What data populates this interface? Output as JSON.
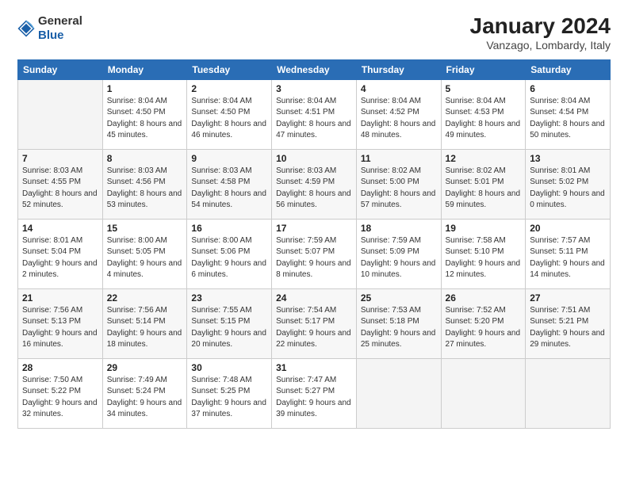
{
  "logo": {
    "general": "General",
    "blue": "Blue"
  },
  "title": "January 2024",
  "subtitle": "Vanzago, Lombardy, Italy",
  "days": [
    "Sunday",
    "Monday",
    "Tuesday",
    "Wednesday",
    "Thursday",
    "Friday",
    "Saturday"
  ],
  "weeks": [
    [
      {
        "date": "",
        "sunrise": "",
        "sunset": "",
        "daylight": ""
      },
      {
        "date": "1",
        "sunrise": "Sunrise: 8:04 AM",
        "sunset": "Sunset: 4:50 PM",
        "daylight": "Daylight: 8 hours and 45 minutes."
      },
      {
        "date": "2",
        "sunrise": "Sunrise: 8:04 AM",
        "sunset": "Sunset: 4:50 PM",
        "daylight": "Daylight: 8 hours and 46 minutes."
      },
      {
        "date": "3",
        "sunrise": "Sunrise: 8:04 AM",
        "sunset": "Sunset: 4:51 PM",
        "daylight": "Daylight: 8 hours and 47 minutes."
      },
      {
        "date": "4",
        "sunrise": "Sunrise: 8:04 AM",
        "sunset": "Sunset: 4:52 PM",
        "daylight": "Daylight: 8 hours and 48 minutes."
      },
      {
        "date": "5",
        "sunrise": "Sunrise: 8:04 AM",
        "sunset": "Sunset: 4:53 PM",
        "daylight": "Daylight: 8 hours and 49 minutes."
      },
      {
        "date": "6",
        "sunrise": "Sunrise: 8:04 AM",
        "sunset": "Sunset: 4:54 PM",
        "daylight": "Daylight: 8 hours and 50 minutes."
      }
    ],
    [
      {
        "date": "7",
        "sunrise": "Sunrise: 8:03 AM",
        "sunset": "Sunset: 4:55 PM",
        "daylight": "Daylight: 8 hours and 52 minutes."
      },
      {
        "date": "8",
        "sunrise": "Sunrise: 8:03 AM",
        "sunset": "Sunset: 4:56 PM",
        "daylight": "Daylight: 8 hours and 53 minutes."
      },
      {
        "date": "9",
        "sunrise": "Sunrise: 8:03 AM",
        "sunset": "Sunset: 4:58 PM",
        "daylight": "Daylight: 8 hours and 54 minutes."
      },
      {
        "date": "10",
        "sunrise": "Sunrise: 8:03 AM",
        "sunset": "Sunset: 4:59 PM",
        "daylight": "Daylight: 8 hours and 56 minutes."
      },
      {
        "date": "11",
        "sunrise": "Sunrise: 8:02 AM",
        "sunset": "Sunset: 5:00 PM",
        "daylight": "Daylight: 8 hours and 57 minutes."
      },
      {
        "date": "12",
        "sunrise": "Sunrise: 8:02 AM",
        "sunset": "Sunset: 5:01 PM",
        "daylight": "Daylight: 8 hours and 59 minutes."
      },
      {
        "date": "13",
        "sunrise": "Sunrise: 8:01 AM",
        "sunset": "Sunset: 5:02 PM",
        "daylight": "Daylight: 9 hours and 0 minutes."
      }
    ],
    [
      {
        "date": "14",
        "sunrise": "Sunrise: 8:01 AM",
        "sunset": "Sunset: 5:04 PM",
        "daylight": "Daylight: 9 hours and 2 minutes."
      },
      {
        "date": "15",
        "sunrise": "Sunrise: 8:00 AM",
        "sunset": "Sunset: 5:05 PM",
        "daylight": "Daylight: 9 hours and 4 minutes."
      },
      {
        "date": "16",
        "sunrise": "Sunrise: 8:00 AM",
        "sunset": "Sunset: 5:06 PM",
        "daylight": "Daylight: 9 hours and 6 minutes."
      },
      {
        "date": "17",
        "sunrise": "Sunrise: 7:59 AM",
        "sunset": "Sunset: 5:07 PM",
        "daylight": "Daylight: 9 hours and 8 minutes."
      },
      {
        "date": "18",
        "sunrise": "Sunrise: 7:59 AM",
        "sunset": "Sunset: 5:09 PM",
        "daylight": "Daylight: 9 hours and 10 minutes."
      },
      {
        "date": "19",
        "sunrise": "Sunrise: 7:58 AM",
        "sunset": "Sunset: 5:10 PM",
        "daylight": "Daylight: 9 hours and 12 minutes."
      },
      {
        "date": "20",
        "sunrise": "Sunrise: 7:57 AM",
        "sunset": "Sunset: 5:11 PM",
        "daylight": "Daylight: 9 hours and 14 minutes."
      }
    ],
    [
      {
        "date": "21",
        "sunrise": "Sunrise: 7:56 AM",
        "sunset": "Sunset: 5:13 PM",
        "daylight": "Daylight: 9 hours and 16 minutes."
      },
      {
        "date": "22",
        "sunrise": "Sunrise: 7:56 AM",
        "sunset": "Sunset: 5:14 PM",
        "daylight": "Daylight: 9 hours and 18 minutes."
      },
      {
        "date": "23",
        "sunrise": "Sunrise: 7:55 AM",
        "sunset": "Sunset: 5:15 PM",
        "daylight": "Daylight: 9 hours and 20 minutes."
      },
      {
        "date": "24",
        "sunrise": "Sunrise: 7:54 AM",
        "sunset": "Sunset: 5:17 PM",
        "daylight": "Daylight: 9 hours and 22 minutes."
      },
      {
        "date": "25",
        "sunrise": "Sunrise: 7:53 AM",
        "sunset": "Sunset: 5:18 PM",
        "daylight": "Daylight: 9 hours and 25 minutes."
      },
      {
        "date": "26",
        "sunrise": "Sunrise: 7:52 AM",
        "sunset": "Sunset: 5:20 PM",
        "daylight": "Daylight: 9 hours and 27 minutes."
      },
      {
        "date": "27",
        "sunrise": "Sunrise: 7:51 AM",
        "sunset": "Sunset: 5:21 PM",
        "daylight": "Daylight: 9 hours and 29 minutes."
      }
    ],
    [
      {
        "date": "28",
        "sunrise": "Sunrise: 7:50 AM",
        "sunset": "Sunset: 5:22 PM",
        "daylight": "Daylight: 9 hours and 32 minutes."
      },
      {
        "date": "29",
        "sunrise": "Sunrise: 7:49 AM",
        "sunset": "Sunset: 5:24 PM",
        "daylight": "Daylight: 9 hours and 34 minutes."
      },
      {
        "date": "30",
        "sunrise": "Sunrise: 7:48 AM",
        "sunset": "Sunset: 5:25 PM",
        "daylight": "Daylight: 9 hours and 37 minutes."
      },
      {
        "date": "31",
        "sunrise": "Sunrise: 7:47 AM",
        "sunset": "Sunset: 5:27 PM",
        "daylight": "Daylight: 9 hours and 39 minutes."
      },
      {
        "date": "",
        "sunrise": "",
        "sunset": "",
        "daylight": ""
      },
      {
        "date": "",
        "sunrise": "",
        "sunset": "",
        "daylight": ""
      },
      {
        "date": "",
        "sunrise": "",
        "sunset": "",
        "daylight": ""
      }
    ]
  ]
}
